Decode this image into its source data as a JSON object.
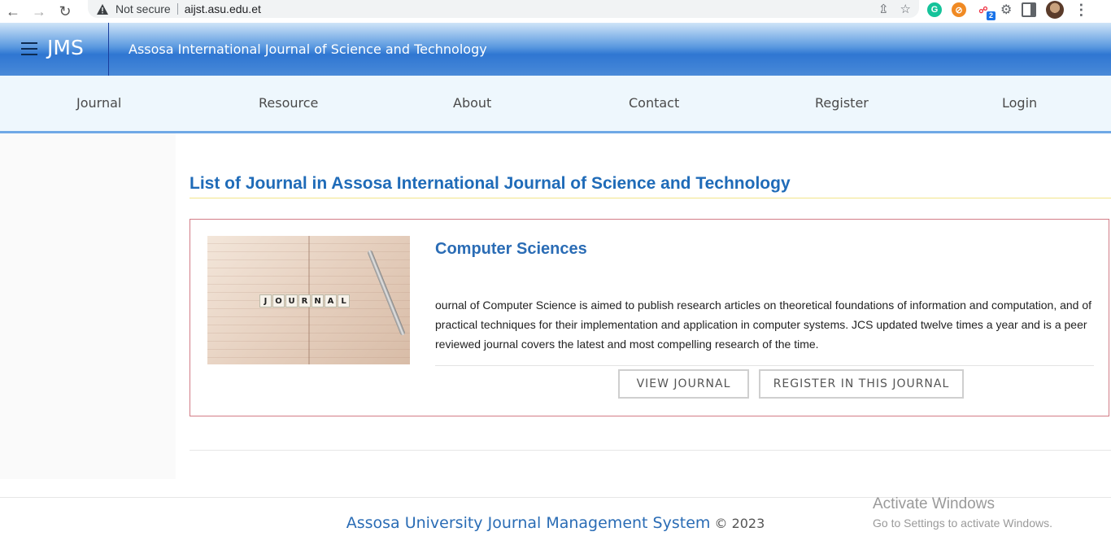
{
  "browser": {
    "security_label": "Not secure",
    "url": "aijst.asu.edu.et",
    "extension_badge": "2"
  },
  "header": {
    "brand": "JMS",
    "site_title": "Assosa International Journal of Science and Technology"
  },
  "nav": {
    "items": [
      {
        "label": "Journal"
      },
      {
        "label": "Resource"
      },
      {
        "label": "About"
      },
      {
        "label": "Contact"
      },
      {
        "label": "Register"
      },
      {
        "label": "Login"
      }
    ]
  },
  "main": {
    "heading": "List of Journal in Assosa International Journal of Science and Technology",
    "journals": [
      {
        "title": "Computer Sciences",
        "description": "ournal of Computer Science is aimed to publish research articles on theoretical foundations of information and computation, and of practical techniques for their implementation and application in computer systems. JCS updated twelve times a year and is a peer reviewed journal covers the latest and most compelling research of the time.",
        "thumbnail_word": [
          "J",
          "O",
          "U",
          "R",
          "N",
          "A",
          "L"
        ],
        "view_button": "VIEW JOURNAL",
        "register_button": "REGISTER IN THIS JOURNAL"
      }
    ]
  },
  "footer": {
    "brand": "Assosa University Journal Management System",
    "copyright": "© 2023"
  },
  "watermark": {
    "line1": "Activate Windows",
    "line2": "Go to Settings to activate Windows."
  },
  "colors": {
    "accent": "#2a6cb5",
    "card_border": "#d27c86",
    "nav_bg": "#eef7fd"
  }
}
